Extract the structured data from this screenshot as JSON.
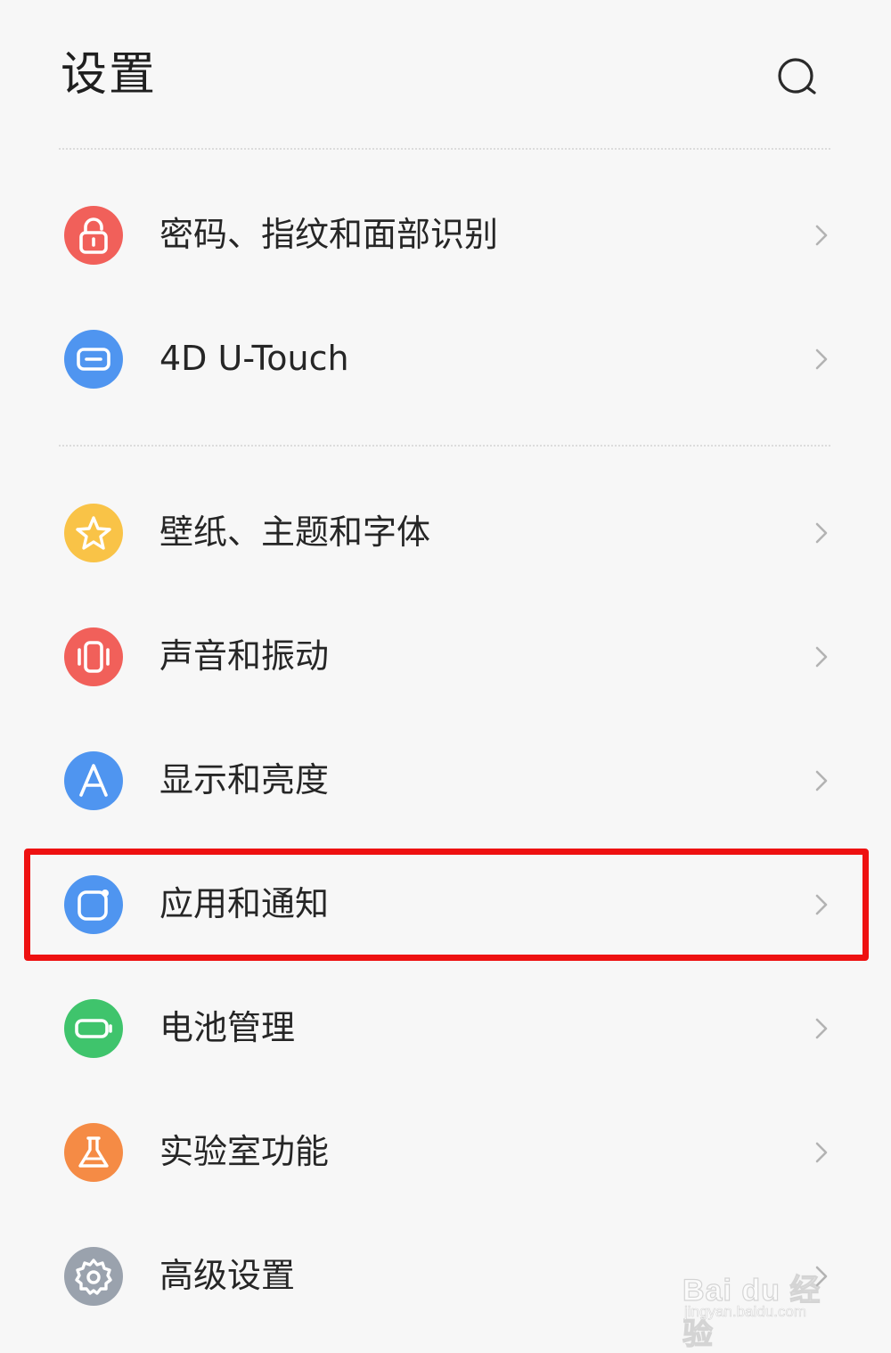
{
  "header": {
    "title": "设置",
    "search_icon": "search-icon"
  },
  "settings": {
    "items": [
      {
        "label": "密码、指纹和面部识别",
        "icon": "lock-icon",
        "color": "#f1605a"
      },
      {
        "label": "4D U-Touch",
        "icon": "touch-panel-icon",
        "color": "#4f95f0"
      },
      {
        "label": "壁纸、主题和字体",
        "icon": "star-icon",
        "color": "#f9c347"
      },
      {
        "label": "声音和振动",
        "icon": "vibration-icon",
        "color": "#f1605a"
      },
      {
        "label": "显示和亮度",
        "icon": "letter-a-icon",
        "color": "#4f95f0"
      },
      {
        "label": "应用和通知",
        "icon": "app-icon",
        "color": "#4f95f0"
      },
      {
        "label": "电池管理",
        "icon": "battery-icon",
        "color": "#3fc46c"
      },
      {
        "label": "实验室功能",
        "icon": "flask-icon",
        "color": "#f58b45"
      },
      {
        "label": "高级设置",
        "icon": "gear-icon",
        "color": "#9aa2ad"
      }
    ]
  },
  "annotation": {
    "highlight_color": "#ee1111",
    "highlighted_item": "应用和通知"
  },
  "watermark": {
    "main": "Bai du 经验",
    "sub": "jingyan.baidu.com"
  }
}
